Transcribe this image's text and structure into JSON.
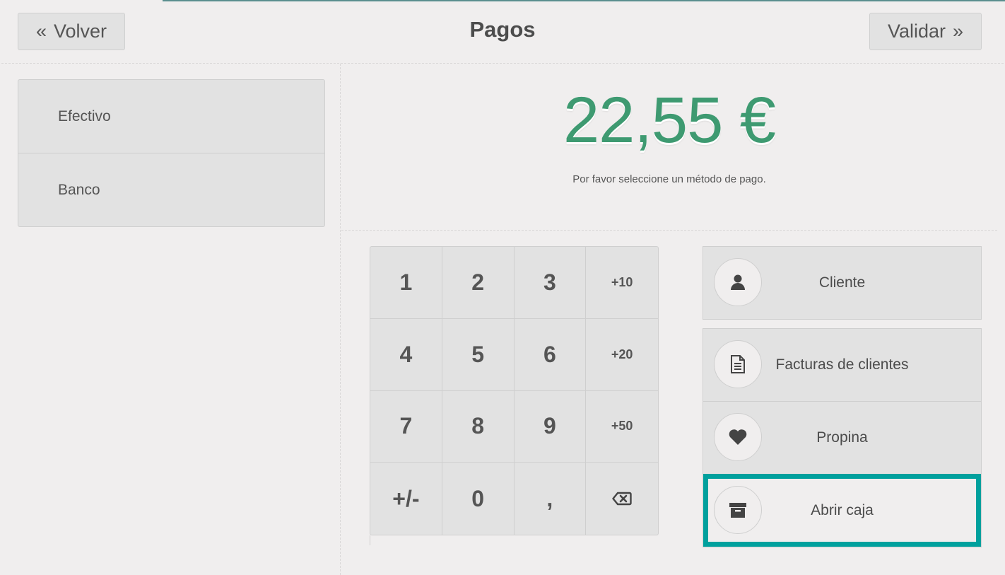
{
  "header": {
    "back_label": "Volver",
    "title": "Pagos",
    "validate_label": "Validar"
  },
  "payment_methods": [
    {
      "label": "Efectivo"
    },
    {
      "label": "Banco"
    }
  ],
  "summary": {
    "amount_due": "22,55 €",
    "hint": "Por favor seleccione un método de pago."
  },
  "numpad": {
    "keys": [
      "1",
      "2",
      "3",
      "+10",
      "4",
      "5",
      "6",
      "+20",
      "7",
      "8",
      "9",
      "+50",
      "+/-",
      "0",
      ",",
      "backspace-icon"
    ]
  },
  "controls": [
    {
      "label": "Cliente",
      "icon": "user-icon"
    },
    {
      "label": "Facturas de clientes",
      "icon": "file-text-icon"
    },
    {
      "label": "Propina",
      "icon": "heart-icon"
    },
    {
      "label": "Abrir caja",
      "icon": "archive-icon",
      "highlighted": true
    }
  ],
  "colors": {
    "accent": "#00a09d",
    "amount": "#3e9a71",
    "background": "#f0eeee",
    "button": "#e2e2e2"
  }
}
